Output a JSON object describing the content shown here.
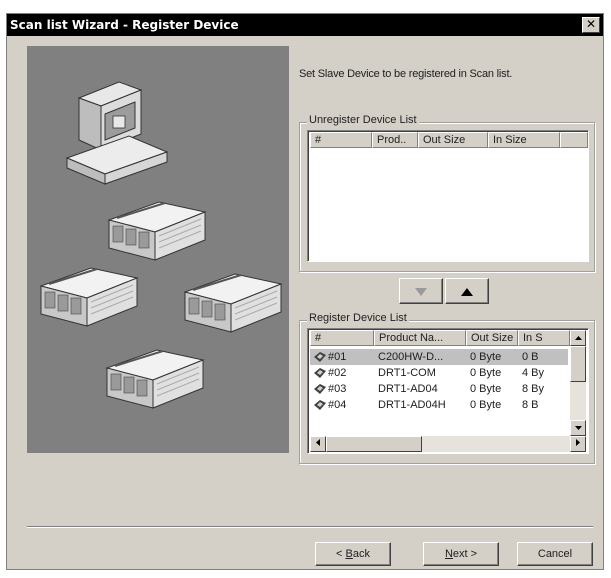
{
  "window": {
    "title": "Scan list Wizard - Register Device",
    "close_glyph": "✕"
  },
  "instruction": "Set Slave Device to be registered in Scan list.",
  "unregister": {
    "label": "Unregister Device List",
    "columns": [
      "#",
      "Prod..",
      "Out Size",
      "In Size"
    ],
    "rows": []
  },
  "move_buttons": {
    "move_down_icon": "arrow-down-icon",
    "move_up_icon": "arrow-up-icon"
  },
  "register": {
    "label": "Register Device List",
    "columns": [
      "#",
      "Product Na...",
      "Out Size",
      "In S"
    ],
    "rows": [
      {
        "num": "#01",
        "product": "C200HW-D...",
        "out": "0 Byte",
        "in": "0 B"
      },
      {
        "num": "#02",
        "product": "DRT1-COM",
        "out": "0 Byte",
        "in": "4 By"
      },
      {
        "num": "#03",
        "product": "DRT1-AD04",
        "out": "0 Byte",
        "in": "8 By"
      },
      {
        "num": "#04",
        "product": "DRT1-AD04H",
        "out": "0 Byte",
        "in": "8 B"
      }
    ],
    "selected_index": 0
  },
  "buttons": {
    "back_prefix": "< ",
    "back_accel": "B",
    "back_rest": "ack",
    "next_accel": "N",
    "next_rest": "ext >",
    "cancel": "Cancel"
  }
}
